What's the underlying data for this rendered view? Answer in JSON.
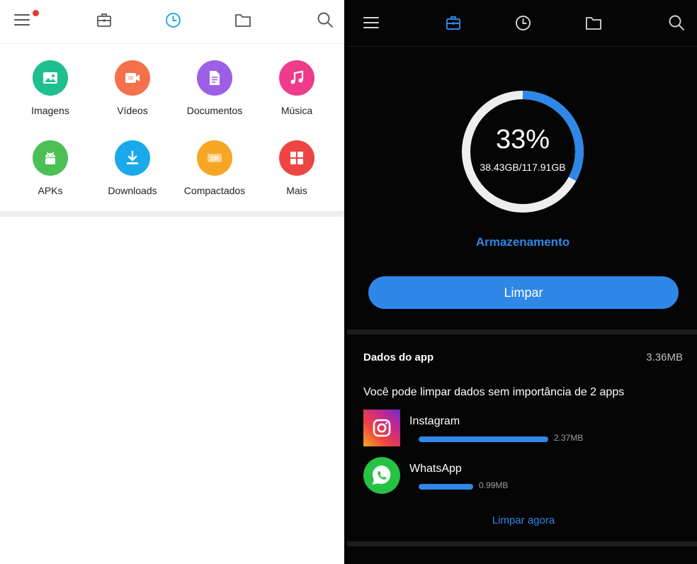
{
  "left_panel": {
    "toolbar": {
      "menu_badge_color": "#e53935",
      "active_tab": "recent",
      "tabs": [
        "menu",
        "tools",
        "recent",
        "files",
        "search"
      ]
    },
    "categories": [
      {
        "label": "Imagens",
        "icon": "image-icon",
        "color": "#1fbf8f"
      },
      {
        "label": "Vídeos",
        "icon": "video-icon",
        "color": "#f4714c"
      },
      {
        "label": "Documentos",
        "icon": "document-icon",
        "color": "#9c5fe6"
      },
      {
        "label": "Música",
        "icon": "music-icon",
        "color": "#ee3b8c"
      },
      {
        "label": "APKs",
        "icon": "android-icon",
        "color": "#4cbf55"
      },
      {
        "label": "Downloads",
        "icon": "download-icon",
        "color": "#1aa9ea"
      },
      {
        "label": "Compactados",
        "icon": "zip-icon",
        "color": "#f6a623"
      },
      {
        "label": "Mais",
        "icon": "grid-icon",
        "color": "#ef4444"
      }
    ],
    "zip_label": "ZIP"
  },
  "right_panel": {
    "toolbar": {
      "active_tab": "tools",
      "tabs": [
        "menu",
        "tools",
        "recent",
        "files",
        "search"
      ]
    },
    "storage": {
      "percent_label": "33%",
      "percent_value": 0.33,
      "usage": "38.43GB/117.91GB",
      "title": "Armazenamento"
    },
    "clean_button": "Limpar",
    "app_data": {
      "title": "Dados do app",
      "total_size": "3.36MB",
      "hint": "Você pode limpar dados sem importância de 2 apps",
      "apps": [
        {
          "name": "Instagram",
          "size": "2.37MB",
          "fraction": 0.705
        },
        {
          "name": "WhatsApp",
          "size": "0.99MB",
          "fraction": 0.295
        }
      ],
      "action": "Limpar agora"
    },
    "accent_color": "#2f87e8"
  }
}
